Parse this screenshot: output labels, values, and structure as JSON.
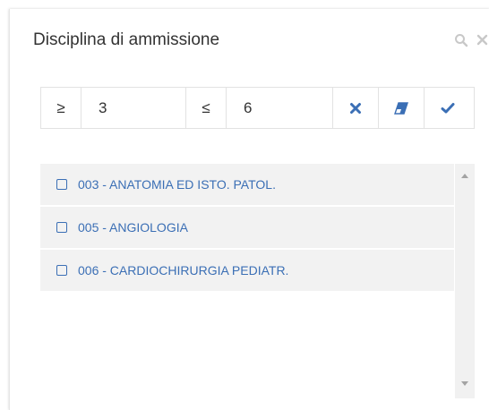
{
  "panel": {
    "title": "Disciplina di ammissione"
  },
  "header_icons": [
    "search-icon",
    "close-icon"
  ],
  "filter": {
    "ge_symbol": "≥",
    "min_value": "3",
    "le_symbol": "≤",
    "max_value": "6",
    "buttons": [
      "clear-icon",
      "eraser-icon",
      "check-icon"
    ]
  },
  "list": {
    "items": [
      {
        "label": "003 - ANATOMIA ED ISTO. PATOL.",
        "checked": false
      },
      {
        "label": "005 - ANGIOLOGIA",
        "checked": false
      },
      {
        "label": "006 - CARDIOCHIRURGIA PEDIATR.",
        "checked": false
      }
    ]
  },
  "colors": {
    "accent": "#3b6fb5",
    "list_item_bg": "#f2f2f2",
    "text": "#333333",
    "muted_icon": "#c8c8c8"
  }
}
